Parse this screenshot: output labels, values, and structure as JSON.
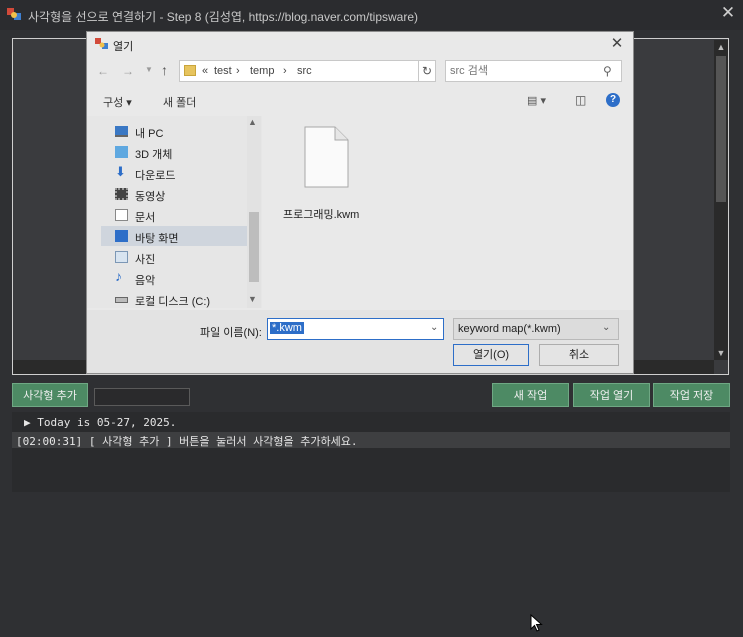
{
  "app": {
    "title": "사각형을 선으로 연결하기 - Step 8 (김성엽, https://blog.naver.com/tipsware)",
    "close_glyph": "✕"
  },
  "dialog": {
    "title": "열기",
    "close_glyph": "✕",
    "address": {
      "prefix": "«",
      "crumbs": [
        "test",
        "temp",
        "src"
      ],
      "separator": "›"
    },
    "search_placeholder": "src 검색",
    "toolbar": {
      "organize_label": "구성 ▾",
      "new_folder_label": "새 폴더"
    },
    "nav_items": [
      {
        "label": "내 PC",
        "icon": "pc-icon"
      },
      {
        "label": "3D 개체",
        "icon": "cube-icon"
      },
      {
        "label": "다운로드",
        "icon": "download-icon"
      },
      {
        "label": "동영상",
        "icon": "video-icon"
      },
      {
        "label": "문서",
        "icon": "document-icon"
      },
      {
        "label": "바탕 화면",
        "icon": "desktop-icon"
      },
      {
        "label": "사진",
        "icon": "picture-icon"
      },
      {
        "label": "음악",
        "icon": "music-icon"
      },
      {
        "label": "로컬 디스크 (C:)",
        "icon": "disk-icon"
      }
    ],
    "file": {
      "name": "프로그래밍.kwm",
      "icon": "file-icon"
    },
    "filename_label": "파일 이름(N):",
    "filename_value": "*.kwm",
    "filter_value": "keyword map(*.kwm)",
    "open_label": "열기(O)",
    "cancel_label": "취소"
  },
  "controls": {
    "add_rect_label": "사각형 추가",
    "new_work_label": "새 작업",
    "open_work_label": "작업 열기",
    "save_work_label": "작업 저장"
  },
  "log": {
    "line1": "▶ Today is 05-27, 2025.",
    "line2": "[02:00:31] [ 사각형 추가 ] 버튼을 눌러서 사각형을 추가하세요."
  },
  "colors": {
    "accent_green": "#4d8a64",
    "selection_blue": "#2d6ec8",
    "background": "#2f3033"
  }
}
